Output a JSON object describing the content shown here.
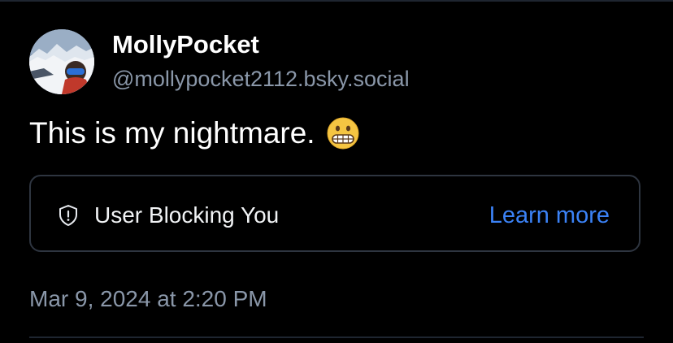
{
  "post": {
    "author": {
      "display_name": "MollyPocket",
      "handle": "@mollypocket2112.bsky.social"
    },
    "text": "This is my nightmare.",
    "emoji": "grimacing-face",
    "notice": {
      "icon": "shield-alert-icon",
      "label": "User Blocking You",
      "link_label": "Learn more"
    },
    "timestamp": "Mar 9, 2024 at 2:20 PM"
  },
  "colors": {
    "background": "#000000",
    "text_primary": "#ffffff",
    "text_secondary": "#8a97a9",
    "link": "#3b82f6",
    "border": "#2e3540"
  }
}
